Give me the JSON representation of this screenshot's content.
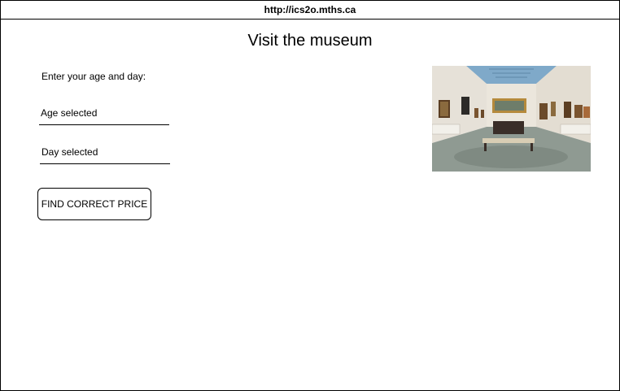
{
  "browser": {
    "url": "http://ics2o.mths.ca"
  },
  "page": {
    "title": "Visit the museum",
    "instruction": "Enter your age and day:"
  },
  "form": {
    "age_placeholder": "Age selected",
    "day_placeholder": "Day selected",
    "submit_label": "FIND CORRECT PRICE"
  },
  "image": {
    "subject": "museum gallery interior"
  }
}
